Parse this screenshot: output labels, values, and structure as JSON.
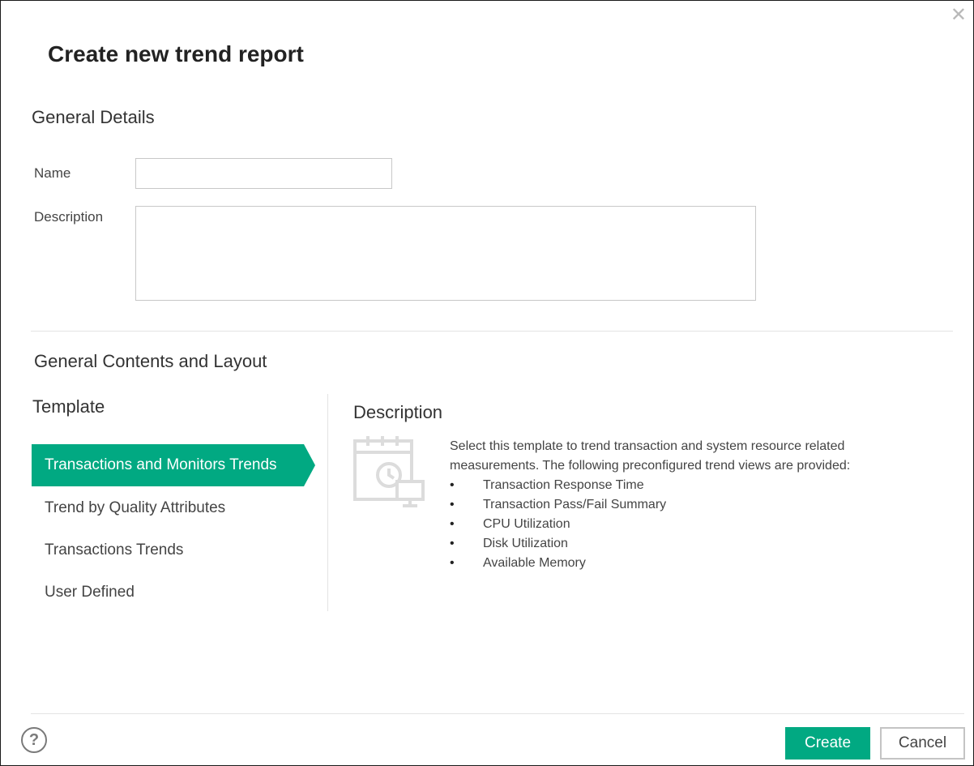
{
  "dialog": {
    "title": "Create new trend report",
    "close_icon": "close-icon"
  },
  "general_details": {
    "heading": "General Details",
    "name_label": "Name",
    "name_value": "",
    "description_label": "Description",
    "description_value": ""
  },
  "contents_layout": {
    "heading": "General Contents and Layout",
    "template_heading": "Template",
    "templates": [
      {
        "label": "Transactions and Monitors Trends",
        "selected": true
      },
      {
        "label": "Trend by Quality Attributes",
        "selected": false
      },
      {
        "label": "Transactions Trends",
        "selected": false
      },
      {
        "label": "User Defined",
        "selected": false
      }
    ],
    "description_heading": "Description",
    "description_text": "Select this template to trend transaction and system resource related measurements. The following preconfigured trend views are provided:",
    "description_items": [
      "Transaction Response Time",
      "Transaction Pass/Fail Summary",
      "CPU Utilization",
      "Disk Utilization",
      "Available Memory"
    ],
    "template_icon": "calendar-monitor-icon"
  },
  "footer": {
    "help_icon": "help-icon",
    "create_label": "Create",
    "cancel_label": "Cancel"
  },
  "colors": {
    "accent": "#01a982",
    "border": "#1a1a1a",
    "divider": "#e3e3e3"
  }
}
